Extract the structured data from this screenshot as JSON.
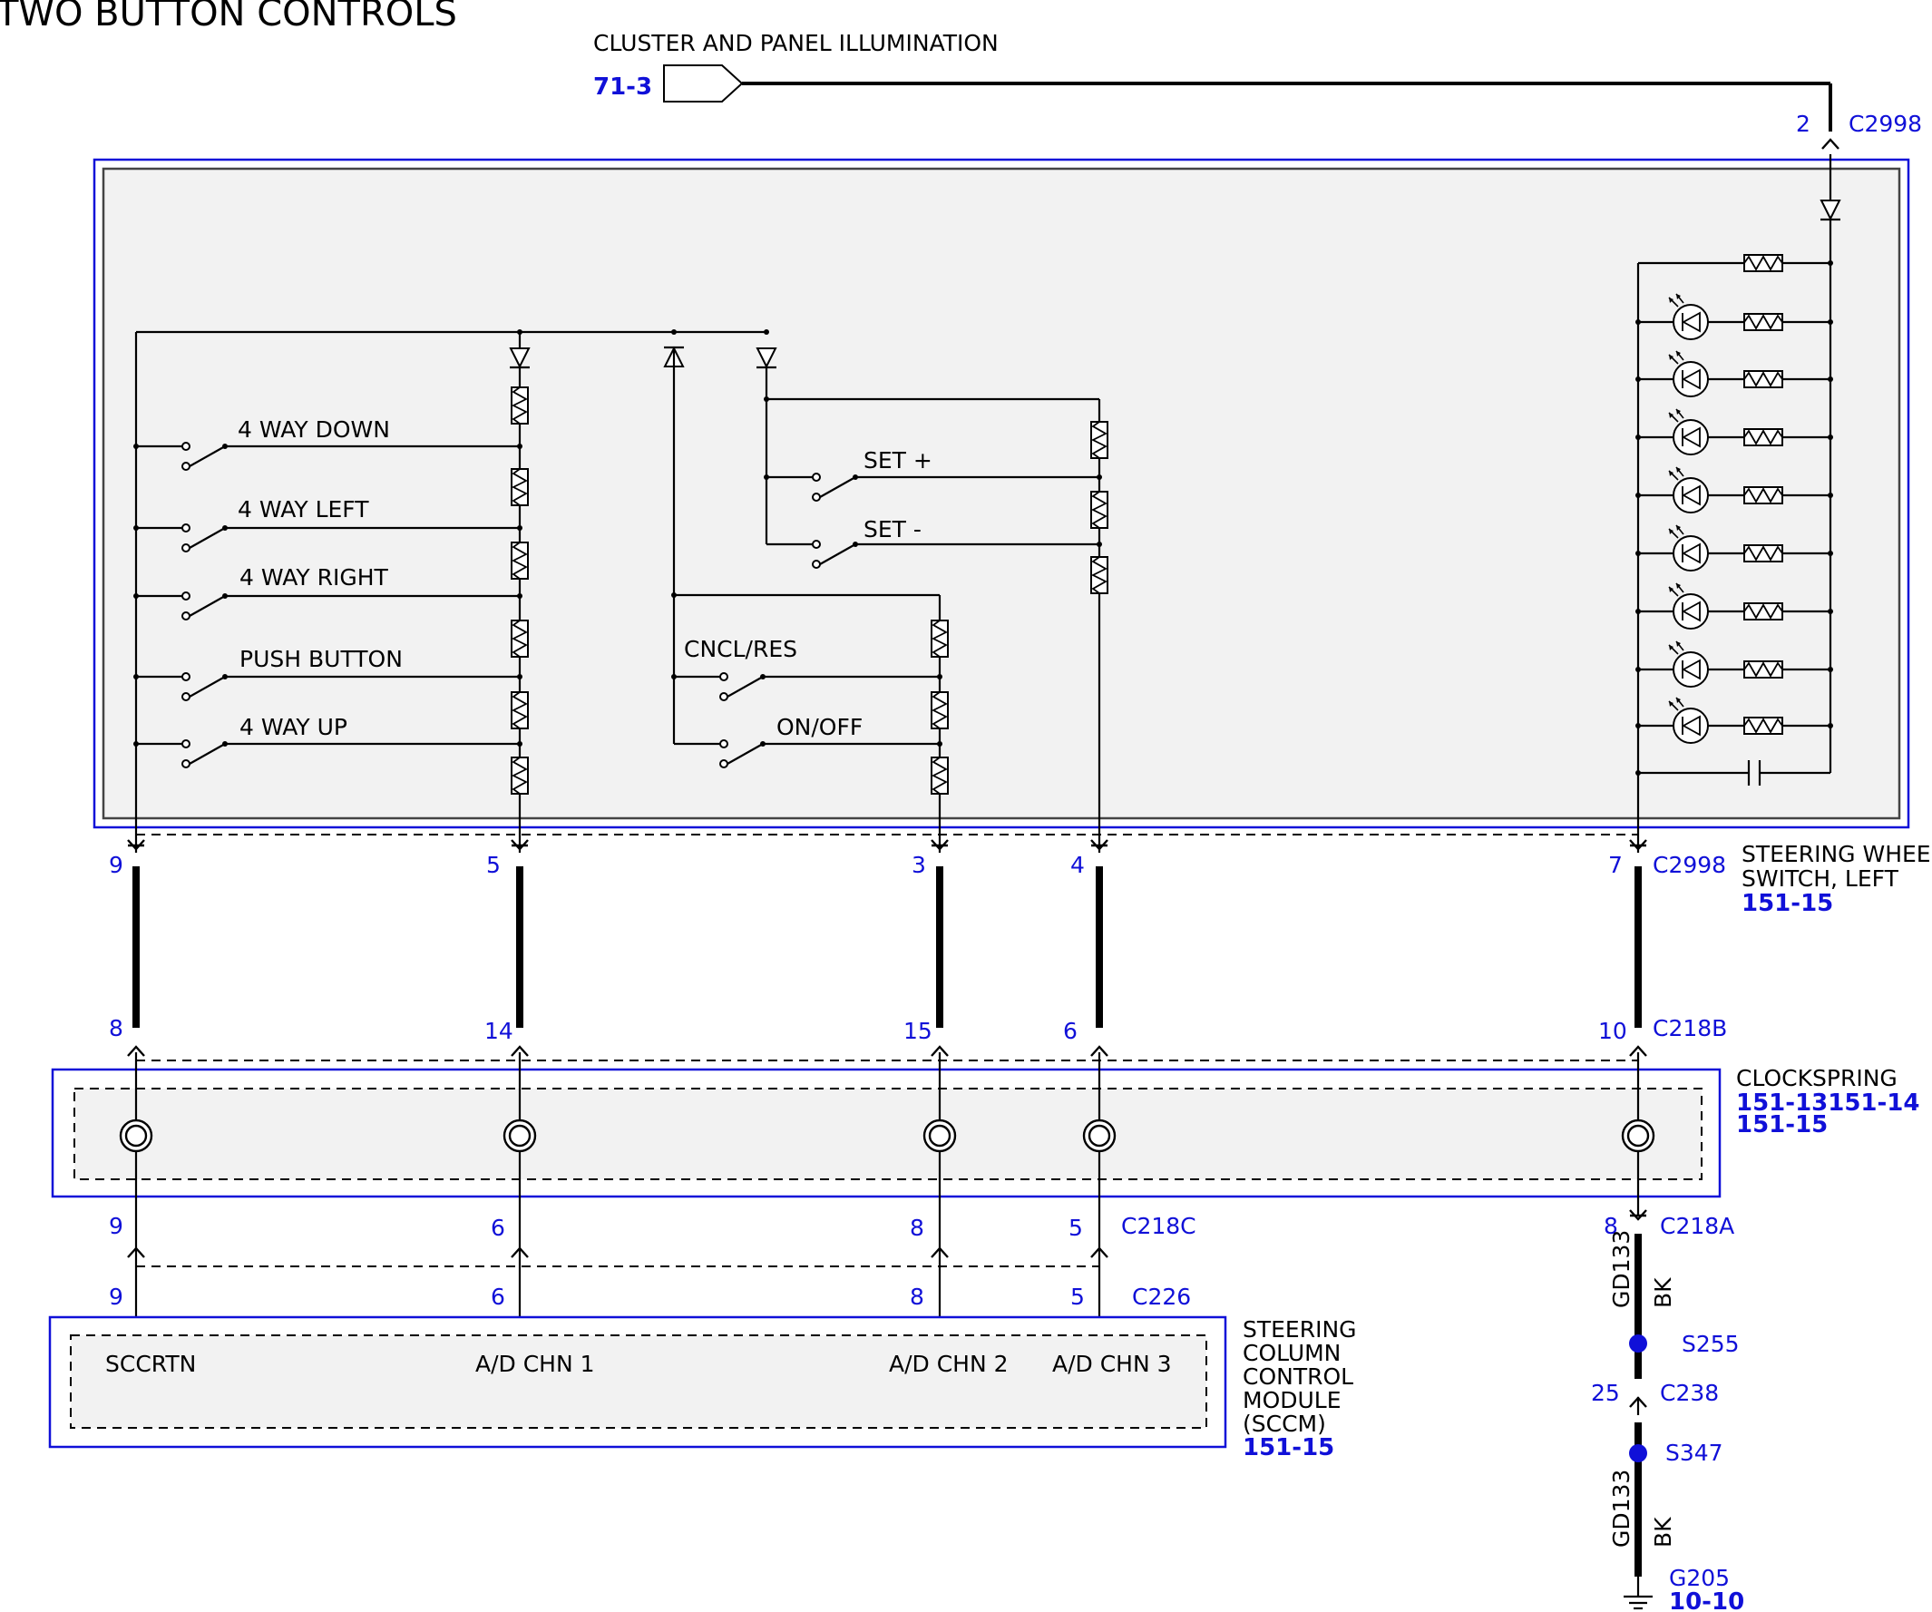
{
  "title": "TWO BUTTON CONTROLS",
  "top_feed": {
    "label": "CLUSTER AND PANEL ILLUMINATION",
    "ref": "71-3",
    "pin": "2",
    "connector": "C2998"
  },
  "switches_left": [
    "4 WAY DOWN",
    "4 WAY LEFT",
    "4 WAY RIGHT",
    "PUSH BUTTON",
    "4 WAY UP"
  ],
  "switches_set": [
    "SET +",
    "SET -"
  ],
  "switches_mid": [
    "CNCL/RES",
    "ON/OFF"
  ],
  "steering_wheel_switch": {
    "name_line1": "STEERING WHEEL",
    "name_line2": "SWITCH, LEFT",
    "ref": "151-15",
    "connector": "C2998",
    "pins": [
      "9",
      "5",
      "3",
      "4",
      "7"
    ]
  },
  "clockspring": {
    "name": "CLOCKSPRING",
    "ref_line1": "151-13151-14",
    "ref_line2": "151-15",
    "upper_connector": "C218B",
    "upper_pins": [
      "8",
      "14",
      "15",
      "6",
      "10"
    ],
    "lower_connector": "C218C",
    "lower_pins": [
      "9",
      "6",
      "8",
      "5"
    ],
    "ground_connector": "C218A",
    "ground_pin": "8"
  },
  "sccm": {
    "name_lines": [
      "STEERING",
      "COLUMN",
      "CONTROL",
      "MODULE",
      "(SCCM)"
    ],
    "ref": "151-15",
    "connector": "C226",
    "pins": [
      "9",
      "6",
      "8",
      "5"
    ],
    "terminals": [
      "SCCRTN",
      "A/D CHN 1",
      "A/D CHN 2",
      "A/D CHN 3"
    ]
  },
  "ground_path": {
    "circuit": "GD133",
    "color": "BK",
    "splice1": "S255",
    "connector_pin": "25",
    "connector": "C238",
    "splice2": "S347",
    "ground": "G205",
    "ground_ref": "10-10"
  },
  "colors": {
    "label_blue": "#1010d8",
    "panel_fill": "#f2f2f2",
    "wire": "#000000"
  }
}
